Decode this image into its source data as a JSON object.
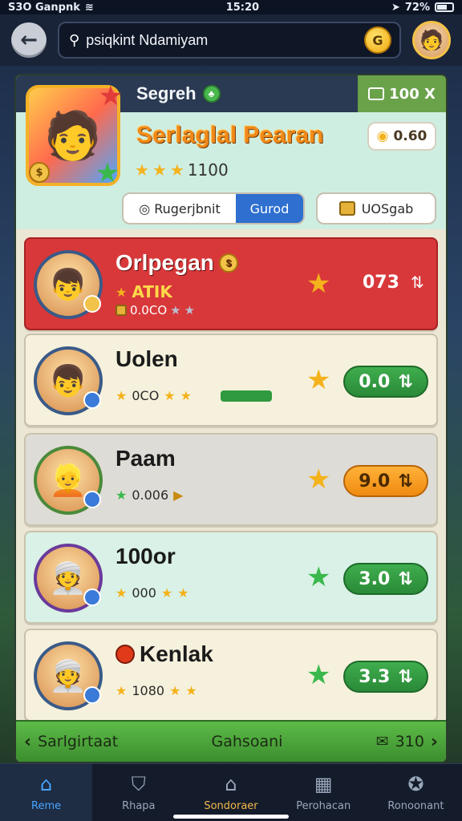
{
  "status_bar": {
    "carrier": "S3O Ganpnk",
    "time": "15:20",
    "battery": "72%"
  },
  "header": {
    "search_placeholder": "psiqkint Ndamiyam",
    "search_value": "psiqkint Ndamiyam",
    "coin_label": "G"
  },
  "profile": {
    "name": "Segreh",
    "currency": "100 X",
    "title": "Serlaglal Pearan",
    "rating_value": "1100",
    "score": "0.60",
    "segment_a": "Rugerjbnit",
    "segment_b": "Gurod",
    "side_button": "UOSgab"
  },
  "rows": [
    {
      "name": "Orlpegan",
      "sub": "ATIK",
      "meta": "0.0CO",
      "value": "073",
      "bg": "#d8383a",
      "pill": "none"
    },
    {
      "name": "Uolen",
      "sub": "0CO",
      "meta": "",
      "value": "0.0",
      "bg": "#f6f1dc",
      "pill": "green"
    },
    {
      "name": "Paam",
      "sub": "0.006",
      "meta": "",
      "value": "9.0",
      "bg": "#dedcd6",
      "pill": "orange"
    },
    {
      "name": "100or",
      "sub": "000",
      "meta": "",
      "value": "3.0",
      "bg": "#d9f1e6",
      "pill": "green"
    },
    {
      "name": "Kenlak",
      "sub": "1080",
      "meta": "",
      "value": "3.3",
      "bg": "#f6f1dc",
      "pill": "green"
    }
  ],
  "bottom_strip": {
    "left": "Sarlgirtaat",
    "center": "Gahsoani",
    "right": "310"
  },
  "tabs": [
    {
      "label": "Reme",
      "icon": "home-icon"
    },
    {
      "label": "Rhapa",
      "icon": "shield-icon"
    },
    {
      "label": "Sondoraer",
      "icon": "house-icon"
    },
    {
      "label": "Perohacan",
      "icon": "chart-icon"
    },
    {
      "label": "Ronoonant",
      "icon": "trophy-icon"
    }
  ],
  "colors": {
    "accent": "#4aa6ff",
    "panel": "#ece6d4",
    "red_row": "#d8383a",
    "green": "#3fae4e",
    "orange": "#f08a10"
  }
}
